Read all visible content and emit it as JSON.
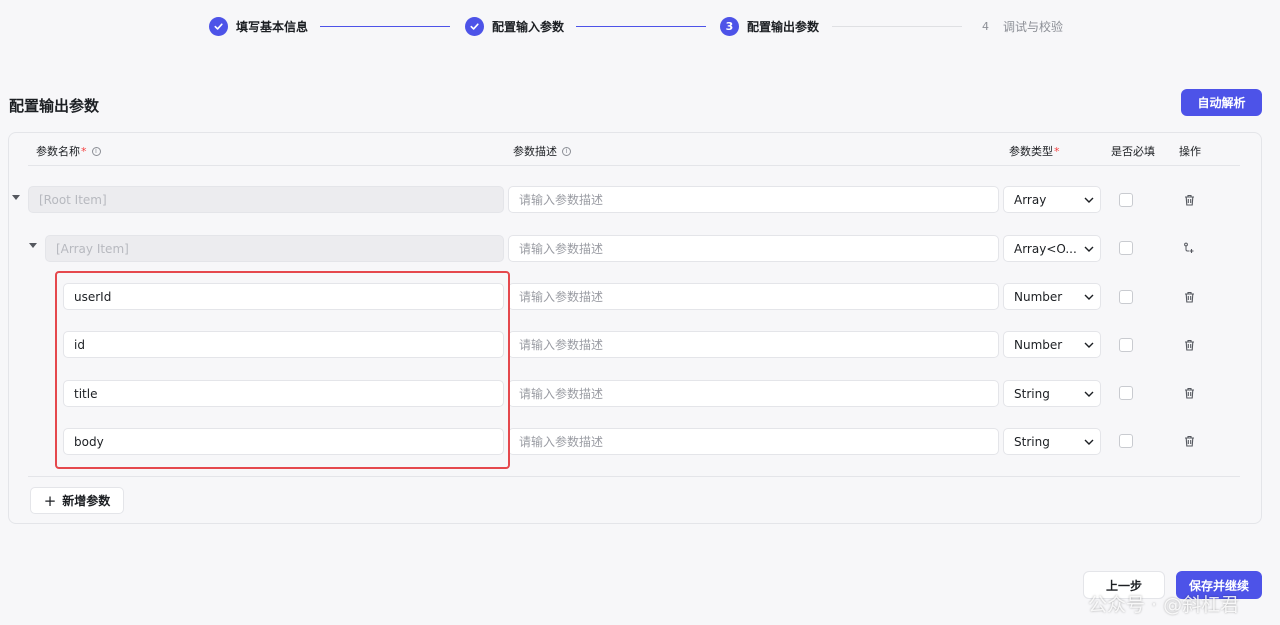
{
  "stepper": {
    "steps": [
      {
        "label": "填写基本信息",
        "status": "done"
      },
      {
        "label": "配置输入参数",
        "status": "done"
      },
      {
        "label": "配置输出参数",
        "status": "active",
        "number": "3"
      },
      {
        "label": "调试与校验",
        "status": "todo",
        "number": "4"
      }
    ]
  },
  "page": {
    "title": "配置输出参数",
    "auto_parse_label": "自动解析"
  },
  "table": {
    "headers": {
      "name": "参数名称",
      "name_required": "*",
      "description": "参数描述",
      "type": "参数类型",
      "type_required": "*",
      "required": "是否必填",
      "actions": "操作"
    },
    "rows": [
      {
        "name": "[Root Item]",
        "name_disabled": true,
        "description_placeholder": "请输入参数描述",
        "type": "Array",
        "required": false,
        "action_icon": "trash-icon",
        "expandable": true
      },
      {
        "name": "[Array Item]",
        "name_disabled": true,
        "description_placeholder": "请输入参数描述",
        "type": "Array<O...",
        "required": false,
        "action_icon": "add-child-icon",
        "expandable": true
      },
      {
        "name": "userId",
        "name_disabled": false,
        "description_placeholder": "请输入参数描述",
        "type": "Number",
        "required": false,
        "action_icon": "trash-icon"
      },
      {
        "name": "id",
        "name_disabled": false,
        "description_placeholder": "请输入参数描述",
        "type": "Number",
        "required": false,
        "action_icon": "trash-icon"
      },
      {
        "name": "title",
        "name_disabled": false,
        "description_placeholder": "请输入参数描述",
        "type": "String",
        "required": false,
        "action_icon": "trash-icon"
      },
      {
        "name": "body",
        "name_disabled": false,
        "description_placeholder": "请输入参数描述",
        "type": "String",
        "required": false,
        "action_icon": "trash-icon"
      }
    ],
    "add_param_label": "新增参数"
  },
  "footer": {
    "prev_label": "上一步",
    "save_continue_label": "保存并继续"
  },
  "watermark": "公众号 · @斜杠君",
  "colors": {
    "primary": "#4d53e8",
    "highlight": "#e5484d",
    "required_star": "#f53f3f"
  }
}
